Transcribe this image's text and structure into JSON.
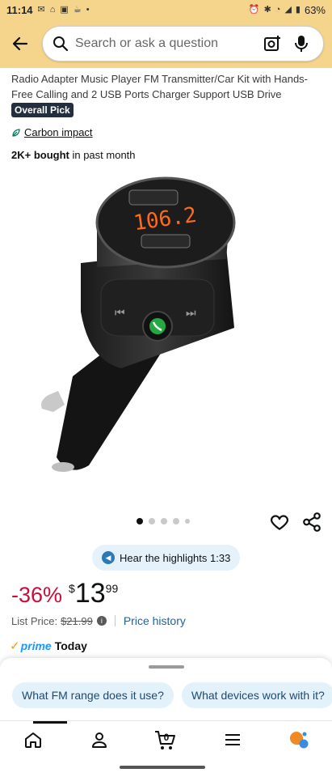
{
  "status_bar": {
    "time": "11:14",
    "battery": "63%"
  },
  "search": {
    "placeholder": "Search or ask a question"
  },
  "product": {
    "title": "Radio Adapter Music Player FM Transmitter/Car Kit with Hands-Free Calling and 2 USB Ports Charger Support USB Drive",
    "badge": "Overall Pick",
    "carbon_label": "Carbon impact",
    "bought_bold": "2K+ bought",
    "bought_rest": " in past month",
    "image_display": {
      "frequency": "106.2"
    }
  },
  "carousel": {
    "count": 5,
    "active_index": 0
  },
  "highlights": {
    "label": "Hear the highlights 1:33"
  },
  "price": {
    "discount": "-36%",
    "currency": "$",
    "whole": "13",
    "cents": "99",
    "list_label": "List Price:",
    "list_value": "$21.99",
    "history_link": "Price history"
  },
  "prime": {
    "brand": "prime",
    "delivery": "Today"
  },
  "sheet": {
    "chips": [
      "What FM range does it use?",
      "What devices work with it?"
    ]
  },
  "nav": {
    "cart_count": "0"
  },
  "colors": {
    "header_bg": "#f5d58c",
    "discount": "#cc0c39",
    "link": "#2162a1",
    "prime_blue": "#1a98ff",
    "chip_bg": "#e3f1fb"
  }
}
